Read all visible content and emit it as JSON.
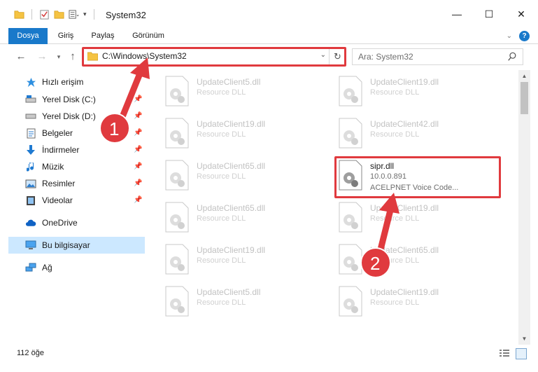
{
  "window": {
    "title": "System32",
    "controls": {
      "minimize": "—",
      "maximize": "☐",
      "close": "✕"
    }
  },
  "ribbon": {
    "tabs": [
      "Dosya",
      "Giriş",
      "Paylaş",
      "Görünüm"
    ],
    "help": "?"
  },
  "navigation": {
    "address": "C:\\Windows\\System32",
    "search_placeholder": "Ara: System32"
  },
  "sidebar": {
    "items": [
      {
        "label": "Hızlı erişim",
        "icon": "star-icon"
      },
      {
        "label": "Yerel Disk (C:)",
        "icon": "drive-icon",
        "pinned": true
      },
      {
        "label": "Yerel Disk (D:)",
        "icon": "drive-icon",
        "pinned": true
      },
      {
        "label": "Belgeler",
        "icon": "documents-icon",
        "pinned": true
      },
      {
        "label": "İndirmeler",
        "icon": "download-icon",
        "pinned": true
      },
      {
        "label": "Müzik",
        "icon": "music-icon",
        "pinned": true
      },
      {
        "label": "Resimler",
        "icon": "pictures-icon",
        "pinned": true
      },
      {
        "label": "Videolar",
        "icon": "videos-icon",
        "pinned": true
      },
      {
        "label": "OneDrive",
        "icon": "cloud-icon"
      },
      {
        "label": "Bu bilgisayar",
        "icon": "computer-icon",
        "selected": true
      },
      {
        "label": "Ağ",
        "icon": "network-icon"
      }
    ]
  },
  "files": [
    {
      "name": "UpdateClient5.dll",
      "type": "Resource DLL"
    },
    {
      "name": "UpdateClient19.dll",
      "type": "Resource DLL"
    },
    {
      "name": "UpdateClient19.dll",
      "type": "Resource DLL"
    },
    {
      "name": "UpdateClient42.dll",
      "type": "Resource DLL"
    },
    {
      "name": "UpdateClient65.dll",
      "type": "Resource DLL"
    },
    {
      "name": "sipr.dll",
      "version": "10.0.0.891",
      "description": "ACELPNET Voice Code...",
      "selected": true
    },
    {
      "name": "UpdateClient65.dll",
      "type": "Resource DLL"
    },
    {
      "name": "UpdateClient19.dll",
      "type": "Resource DLL"
    },
    {
      "name": "UpdateClient19.dll",
      "type": "Resource DLL"
    },
    {
      "name": "UpdateClient65.dll",
      "type": "Resource DLL"
    },
    {
      "name": "UpdateClient5.dll",
      "type": "Resource DLL"
    },
    {
      "name": "UpdateClient19.dll",
      "type": "Resource DLL"
    }
  ],
  "status": {
    "item_count": "112 öğe"
  },
  "annotations": {
    "badge1": "1",
    "badge2": "2",
    "color": "#e03a3e"
  }
}
